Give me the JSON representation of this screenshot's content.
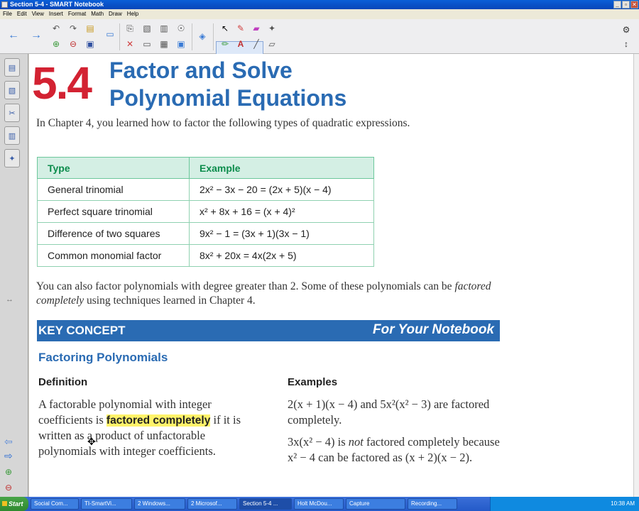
{
  "window": {
    "title": "Section 5-4 - SMART Notebook",
    "controls": [
      "_",
      "▫",
      "✕"
    ]
  },
  "menu": [
    "File",
    "Edit",
    "View",
    "Insert",
    "Format",
    "Math",
    "Draw",
    "Help"
  ],
  "sidebar_icons": [
    "page-sorter-icon",
    "gallery-icon",
    "attachments-icon",
    "properties-icon",
    "addons-icon"
  ],
  "page": {
    "chapter_number": "5.4",
    "title_line1": "Factor and Solve",
    "title_line2": "Polynomial Equations",
    "intro": "In Chapter 4, you learned how to factor the following types of quadratic expressions.",
    "table": {
      "headers": [
        "Type",
        "Example"
      ],
      "rows": [
        [
          "General trinomial",
          "2x² − 3x − 20 = (2x + 5)(x − 4)"
        ],
        [
          "Perfect square trinomial",
          "x² + 8x + 16 = (x + 4)²"
        ],
        [
          "Difference of two squares",
          "9x² − 1 = (3x + 1)(3x − 1)"
        ],
        [
          "Common monomial factor",
          "8x² + 20x = 4x(2x + 5)"
        ]
      ]
    },
    "para2_a": "You can also factor polynomials with degree greater than 2. Some of these polynomials can be ",
    "para2_em": "factored completely",
    "para2_b": " using techniques learned in Chapter 4.",
    "key_concept": "KEY CONCEPT",
    "for_your_notebook": "For Your Notebook",
    "section_heading": "Factoring Polynomials",
    "definition_heading": "Definition",
    "examples_heading": "Examples",
    "definition_a": "A factorable polynomial with integer coefficients is ",
    "definition_highlight": "factored completely",
    "definition_b": " if it is written as a product of unfactorable polynomials with integer coefficients.",
    "example1": "2(x + 1)(x − 4) and 5x²(x² − 3) are factored completely.",
    "example2_a": "3x(x² − 4) is ",
    "example2_em": "not",
    "example2_b": " factored completely because x² − 4 can be factored as (x + 2)(x − 2)."
  },
  "taskbar": {
    "start": "Start",
    "tasks": [
      "Social Com...",
      "TI-SmartVi...",
      "2 Windows...",
      "2 Microsof...",
      "Section 5-4 ...",
      "Holt McDou...",
      "Capture",
      "Recording..."
    ],
    "clock": "10:38 AM"
  }
}
